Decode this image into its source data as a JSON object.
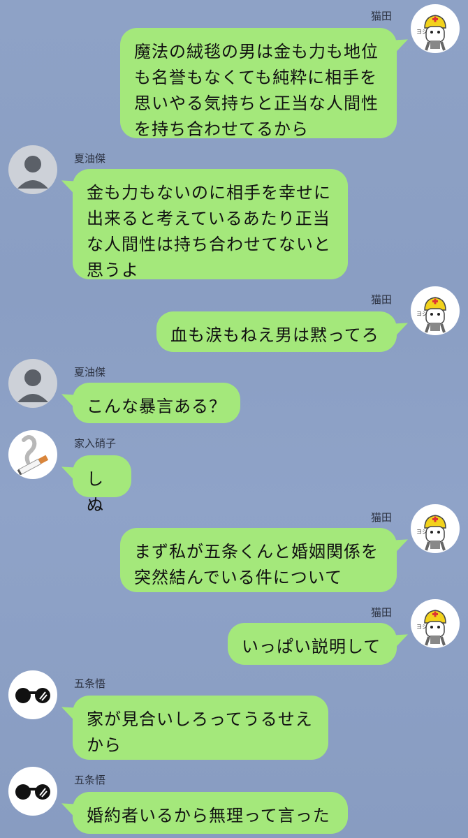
{
  "messages": [
    {
      "sender": "猫田",
      "side": "right",
      "avatar": "cat-helmet-icon",
      "text": "魔法の絨毯の男は金も力も地位\nも名誉もなくても純粋に相手を\n思いやる気持ちと正当な人間性\nを持ち合わせてるから"
    },
    {
      "sender": "夏油傑",
      "side": "left",
      "avatar": "default-user-icon",
      "text": "金も力もないのに相手を幸せに\n出来ると考えているあたり正当\nな人間性は持ち合わせてないと\n思うよ"
    },
    {
      "sender": "猫田",
      "side": "right",
      "avatar": "cat-helmet-icon",
      "text": "血も涙もねえ男は黙ってろ"
    },
    {
      "sender": "夏油傑",
      "side": "left",
      "avatar": "default-user-icon",
      "text": "こんな暴言ある？"
    },
    {
      "sender": "家入硝子",
      "side": "left",
      "avatar": "cigarette-icon",
      "text": "しぬ"
    },
    {
      "sender": "猫田",
      "side": "right",
      "avatar": "cat-helmet-icon",
      "text": "まず私が五条くんと婚姻関係を\n突然結んでいる件について"
    },
    {
      "sender": "猫田",
      "side": "right",
      "avatar": "cat-helmet-icon",
      "text": "いっぱい説明して"
    },
    {
      "sender": "五条悟",
      "side": "left",
      "avatar": "sunglasses-icon",
      "text": "家が見合いしろってうるせえ\nから"
    },
    {
      "sender": "五条悟",
      "side": "left",
      "avatar": "sunglasses-icon",
      "text": "婚約者いるから無理って言った"
    }
  ],
  "colors": {
    "bubble": "#a4e87b",
    "background": "#8ea2c6"
  }
}
